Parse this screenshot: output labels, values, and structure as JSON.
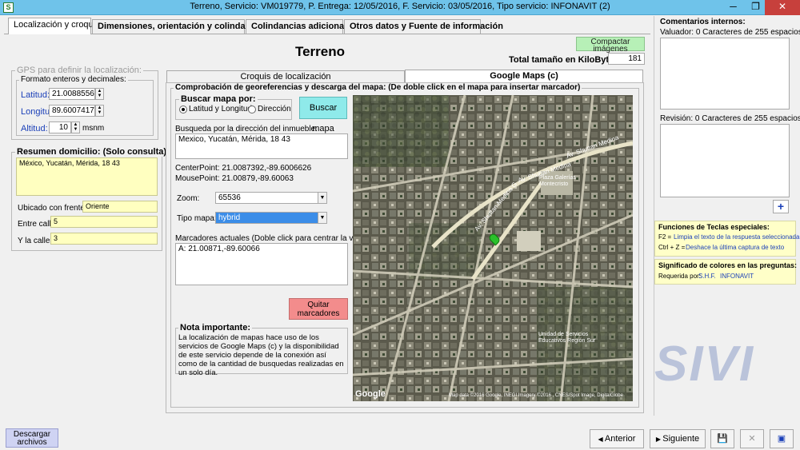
{
  "window": {
    "title": "Terreno, Servicio: VM019779, P. Entrega: 12/05/2016, F. Servicio: 03/05/2016, Tipo servicio: INFONAVIT (2)",
    "app_icon": "S",
    "minimize": "─",
    "maximize": "❐",
    "close": "✕"
  },
  "tabs": [
    {
      "label": "Localización y croquis"
    },
    {
      "label": "Dimensiones, orientación y colindancias"
    },
    {
      "label": "Colindancias adicionales"
    },
    {
      "label": "Otros datos y Fuente de información"
    }
  ],
  "page": {
    "title": "Terreno",
    "compact_button": "Compactar imágenes",
    "total_label": "Total tamaño en KiloBytes:",
    "total_value": "181"
  },
  "gps": {
    "title": "GPS para definir la localización:",
    "subtitle": "Formato enteros y decimales:",
    "lat_label": "Latitud:",
    "lat_value": "21.0088556",
    "lon_label": "Longitud:",
    "lon_value": "89.6007417",
    "alt_label": "Altitud:",
    "alt_value": "10",
    "alt_unit": "msnm"
  },
  "domicilio": {
    "title": "Resumen domicilio: (Solo consulta)",
    "value": "México, Yucatán, Mérida, 18 43",
    "frente_label": "Ubicado con frente a",
    "frente_value": "Oriente",
    "entre_label": "Entre calle",
    "entre_value": "5",
    "ylacalle_label": "Y la calle",
    "ylacalle_value": "3"
  },
  "inner_tabs": [
    {
      "label": "Croquis de localización"
    },
    {
      "label": "Google Maps (c)"
    }
  ],
  "maps": {
    "header": "Comprobación de georeferencias y descarga del mapa: (De doble click en el mapa para insertar marcador)",
    "search_title": "Buscar mapa por:",
    "radio_latlon": "Latitud y Longitud",
    "radio_dir": "Dirección",
    "search_button": "Buscar mapa",
    "address_label": "Busqueda por la dirección del inmueble:",
    "address_value": "Mexico, Yucatán, Mérida, 18 43",
    "center_point": "CenterPoint: 21.0087392,-89.6006626",
    "mouse_point": "MousePoint:  21.00879,-89.60063",
    "zoom_label": "Zoom:",
    "zoom_value": "65536",
    "tipo_label": "Tipo mapa:",
    "tipo_value": "hybrid",
    "markers_label": "Marcadores actuales (Doble click para centrar la vista)",
    "markers_value": "A: 21.00871,-89.60066",
    "remove_button": "Quitar marcadores",
    "note_title": "Nota importante:",
    "note_text": "La localización de mapas hace uso de los servicios de Google Maps (c) y la disponibilidad de este servicio depende de la conexión así como de la cantidad de busquedas realizadas en un solo día.",
    "map_logo": "Google",
    "map_copyright": "Map data ©2016 Google, INEGI  Imagery ©2016 , CNES/Spot Image, DigitalGlobe",
    "map_labels": {
      "street1": "Av. Shuttan Medina",
      "street2": "Av. Shuttan Medina G",
      "street3": "Av. Shuttan Medina",
      "place1": "Plaza Galerías Montecristo",
      "place2": "Unidad de Servicios Educativos Región Sur"
    }
  },
  "comments": {
    "title": "Comentarios internos:",
    "valuador_label": "Valuador: 0 Caracteres de 255 espacios",
    "revision_label": "Revisión: 0 Caracteres de 255 espacios",
    "add_button": "+"
  },
  "keys": {
    "title": "Funciones de Teclas especiales:",
    "f2_key": "F2 =",
    "f2_text": "Limpia el texto de la respuesta seleccionada",
    "ctrlz_key": "Ctrl + Z =",
    "ctrlz_text": "Deshace la última captura de texto"
  },
  "colors": {
    "title": "Significado de colores en las preguntas:",
    "req_label": "Requerida por:",
    "req_shf": "S.H.F.",
    "req_infonavit": "INFONAVIT"
  },
  "watermark": "SIVI",
  "bottom": {
    "download": "Descargar archivos",
    "prev": "Anterior",
    "next": "Siguiente",
    "save_icon": "💾",
    "cancel_icon": "✕",
    "print_icon": "▣"
  }
}
